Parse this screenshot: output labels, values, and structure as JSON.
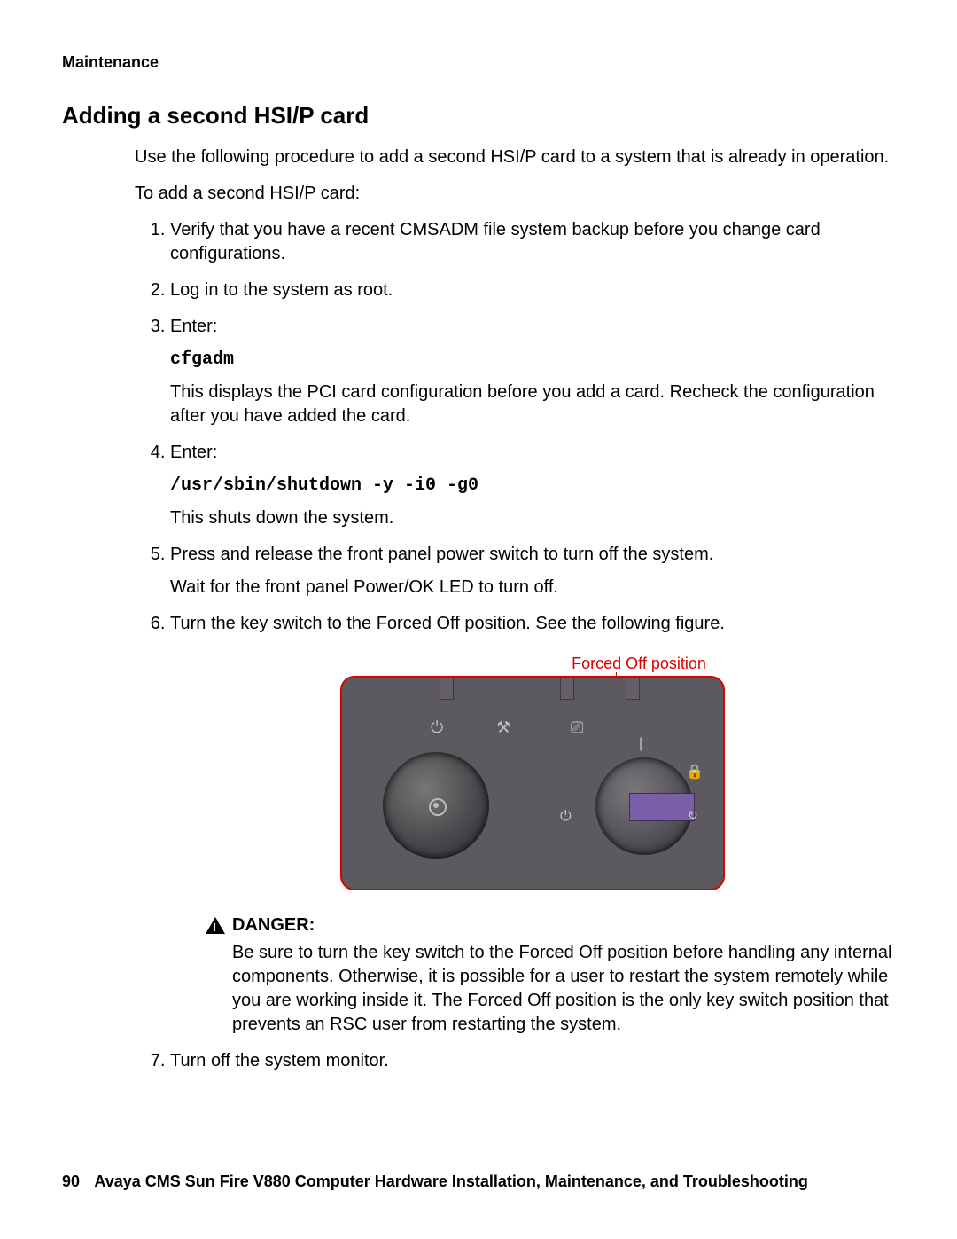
{
  "breadcrumb": "Maintenance",
  "title": "Adding a second HSI/P card",
  "intro": "Use the following procedure to add a second HSI/P card to a system that is already in operation.",
  "lead_in": "To add a second HSI/P card:",
  "steps": {
    "s1": "Verify that you have a recent CMSADM file system backup before you change card configurations.",
    "s2": "Log in to the system as root.",
    "s3": "Enter:",
    "s3_code": "cfgadm",
    "s3_after": "This displays the PCI card configuration before you add a card. Recheck the configuration after you have added the card.",
    "s4": "Enter:",
    "s4_code": "/usr/sbin/shutdown -y -i0 -g0",
    "s4_after": "This shuts down the system.",
    "s5": "Press and release the front panel power switch to turn off the system.",
    "s5_after": "Wait for the front panel Power/OK LED to turn off.",
    "s6": "Turn the key switch to the Forced Off position. See the following figure.",
    "s7": "Turn off the system monitor."
  },
  "figure": {
    "label": "Forced Off position",
    "positions": {
      "top": "|",
      "lock": "🔒",
      "refresh": "↻",
      "off": "⏻"
    },
    "icons": {
      "power": "⏻",
      "wrench": "⚒",
      "card": "⎚"
    }
  },
  "danger": {
    "heading": "DANGER:",
    "text": "Be sure to turn the key switch to the Forced Off position before handling any internal components. Otherwise, it is possible for a user to restart the system remotely while you are working inside it. The Forced Off position is the only key switch position that prevents an RSC user from restarting the system."
  },
  "footer": {
    "page": "90",
    "text": "Avaya CMS Sun Fire V880 Computer Hardware Installation, Maintenance, and Troubleshooting"
  }
}
